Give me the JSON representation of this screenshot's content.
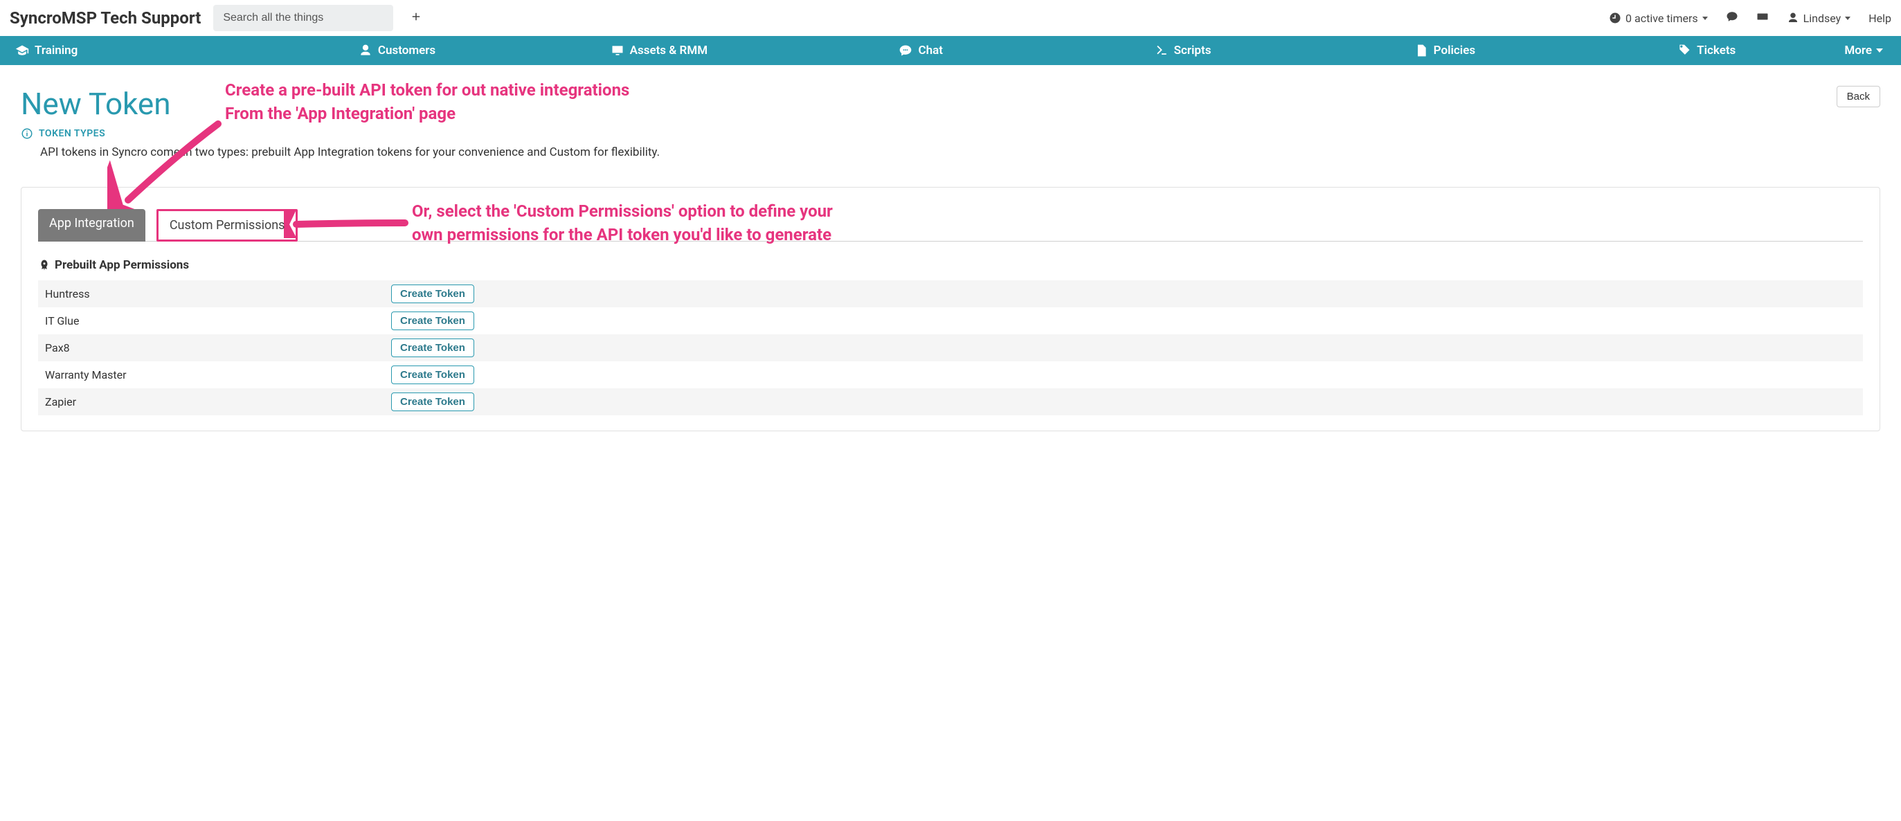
{
  "header": {
    "brand": "SyncroMSP Tech Support",
    "search_placeholder": "Search all the things",
    "timers_text": "0 active timers",
    "user_name": "Lindsey",
    "help": "Help"
  },
  "nav": {
    "training": "Training",
    "customers": "Customers",
    "assets": "Assets & RMM",
    "chat": "Chat",
    "scripts": "Scripts",
    "policies": "Policies",
    "tickets": "Tickets",
    "more": "More"
  },
  "page": {
    "title": "New Token",
    "token_types_label": "TOKEN TYPES",
    "token_desc": "API tokens in Syncro come in two types: prebuilt App Integration tokens for your convenience and Custom for flexibility.",
    "back": "Back"
  },
  "tabs": {
    "app_integration": "App Integration",
    "custom_permissions": "Custom Permissions"
  },
  "section": {
    "title": "Prebuilt App Permissions"
  },
  "rows": [
    {
      "name": "Huntress",
      "btn": "Create Token"
    },
    {
      "name": "IT Glue",
      "btn": "Create Token"
    },
    {
      "name": "Pax8",
      "btn": "Create Token"
    },
    {
      "name": "Warranty Master",
      "btn": "Create Token"
    },
    {
      "name": "Zapier",
      "btn": "Create Token"
    }
  ],
  "annotations": {
    "a1_line1": "Create a pre-built API token for out native integrations",
    "a1_line2": "From the 'App Integration' page",
    "a2_line1": "Or, select the 'Custom Permissions' option to define your",
    "a2_line2": "own permissions for the API token you'd like to generate"
  }
}
